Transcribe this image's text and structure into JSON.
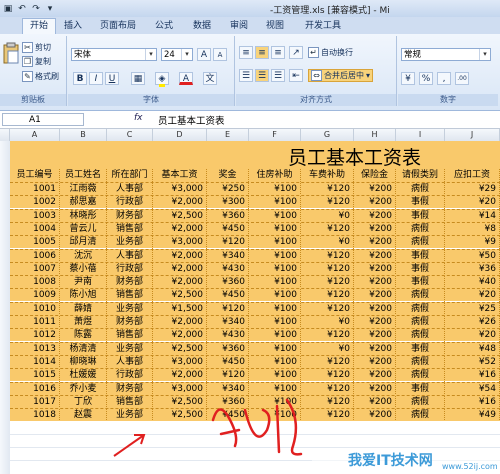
{
  "window": {
    "title": "-工资管理.xls [兼容模式] - Mi"
  },
  "ribbon_tabs": [
    "开始",
    "插入",
    "页面布局",
    "公式",
    "数据",
    "审阅",
    "视图",
    "开发工具"
  ],
  "clipboard": {
    "cut": "剪切",
    "copy": "复制",
    "format_painter": "格式刷",
    "label": "剪贴板"
  },
  "font": {
    "name": "宋体",
    "size": "24",
    "label": "字体",
    "bold": "B",
    "italic": "I",
    "underline": "U",
    "grow": "A",
    "shrink": "A",
    "fontcolor": "A"
  },
  "alignment": {
    "wrap": "自动换行",
    "merge": "合并后居中",
    "label": "对齐方式"
  },
  "number": {
    "format": "常规",
    "label": "数字",
    "percent": "%",
    "comma": ",",
    "decimals": ".00"
  },
  "formula_bar": {
    "name_box": "A1",
    "fx": "fx",
    "value": "员工基本工资表"
  },
  "columns": [
    "A",
    "B",
    "C",
    "D",
    "E",
    "F",
    "G",
    "H",
    "I",
    "J"
  ],
  "sheet": {
    "title": "员工基本工资表",
    "headers": [
      "员工编号",
      "员工姓名",
      "所在部门",
      "基本工资",
      "奖金",
      "住房补助",
      "车费补助",
      "保险金",
      "请假类别",
      "应扣工资"
    ],
    "rows": [
      [
        "1001",
        "江雨薇",
        "人事部",
        "¥3,000",
        "¥250",
        "¥100",
        "¥120",
        "¥200",
        "病假",
        "¥29"
      ],
      [
        "1002",
        "郝思嘉",
        "行政部",
        "¥2,000",
        "¥300",
        "¥100",
        "¥120",
        "¥200",
        "事假",
        "¥20"
      ],
      [
        "1003",
        "林晓彤",
        "财务部",
        "¥2,500",
        "¥360",
        "¥100",
        "¥0",
        "¥200",
        "事假",
        "¥14"
      ],
      [
        "1004",
        "曾云儿",
        "销售部",
        "¥2,000",
        "¥450",
        "¥100",
        "¥120",
        "¥200",
        "病假",
        "¥8"
      ],
      [
        "1005",
        "邱月清",
        "业务部",
        "¥3,000",
        "¥120",
        "¥100",
        "¥0",
        "¥200",
        "病假",
        "¥9"
      ],
      [
        "1006",
        "沈沉",
        "人事部",
        "¥2,000",
        "¥340",
        "¥100",
        "¥120",
        "¥200",
        "事假",
        "¥50"
      ],
      [
        "1007",
        "蔡小蓓",
        "行政部",
        "¥2,000",
        "¥430",
        "¥100",
        "¥120",
        "¥200",
        "事假",
        "¥36"
      ],
      [
        "1008",
        "尹南",
        "财务部",
        "¥2,000",
        "¥360",
        "¥100",
        "¥120",
        "¥200",
        "事假",
        "¥40"
      ],
      [
        "1009",
        "陈小旭",
        "销售部",
        "¥2,500",
        "¥450",
        "¥100",
        "¥120",
        "¥200",
        "病假",
        "¥20"
      ],
      [
        "1010",
        "薛婧",
        "业务部",
        "¥1,500",
        "¥120",
        "¥100",
        "¥120",
        "¥200",
        "病假",
        "¥25"
      ],
      [
        "1011",
        "萧煜",
        "财务部",
        "¥2,000",
        "¥340",
        "¥100",
        "¥0",
        "¥200",
        "病假",
        "¥26"
      ],
      [
        "1012",
        "陈露",
        "销售部",
        "¥2,000",
        "¥430",
        "¥100",
        "¥120",
        "¥200",
        "病假",
        "¥20"
      ],
      [
        "1013",
        "杨清清",
        "业务部",
        "¥2,500",
        "¥360",
        "¥100",
        "¥0",
        "¥200",
        "事假",
        "¥48"
      ],
      [
        "1014",
        "柳晓琳",
        "人事部",
        "¥3,000",
        "¥450",
        "¥100",
        "¥120",
        "¥200",
        "病假",
        "¥52"
      ],
      [
        "1015",
        "杜媛媛",
        "行政部",
        "¥2,000",
        "¥120",
        "¥100",
        "¥120",
        "¥200",
        "病假",
        "¥16"
      ],
      [
        "1016",
        "乔小麦",
        "财务部",
        "¥3,000",
        "¥340",
        "¥100",
        "¥120",
        "¥200",
        "事假",
        "¥54"
      ],
      [
        "1017",
        "丁欣",
        "销售部",
        "¥2,500",
        "¥360",
        "¥100",
        "¥120",
        "¥200",
        "病假",
        "¥16"
      ],
      [
        "1018",
        "赵震",
        "业务部",
        "¥2,500",
        "¥450",
        "¥100",
        "¥120",
        "¥200",
        "病假",
        "¥49"
      ]
    ]
  },
  "watermark": {
    "main": "我爱IT技术网",
    "sub": "www.52ij.com"
  }
}
